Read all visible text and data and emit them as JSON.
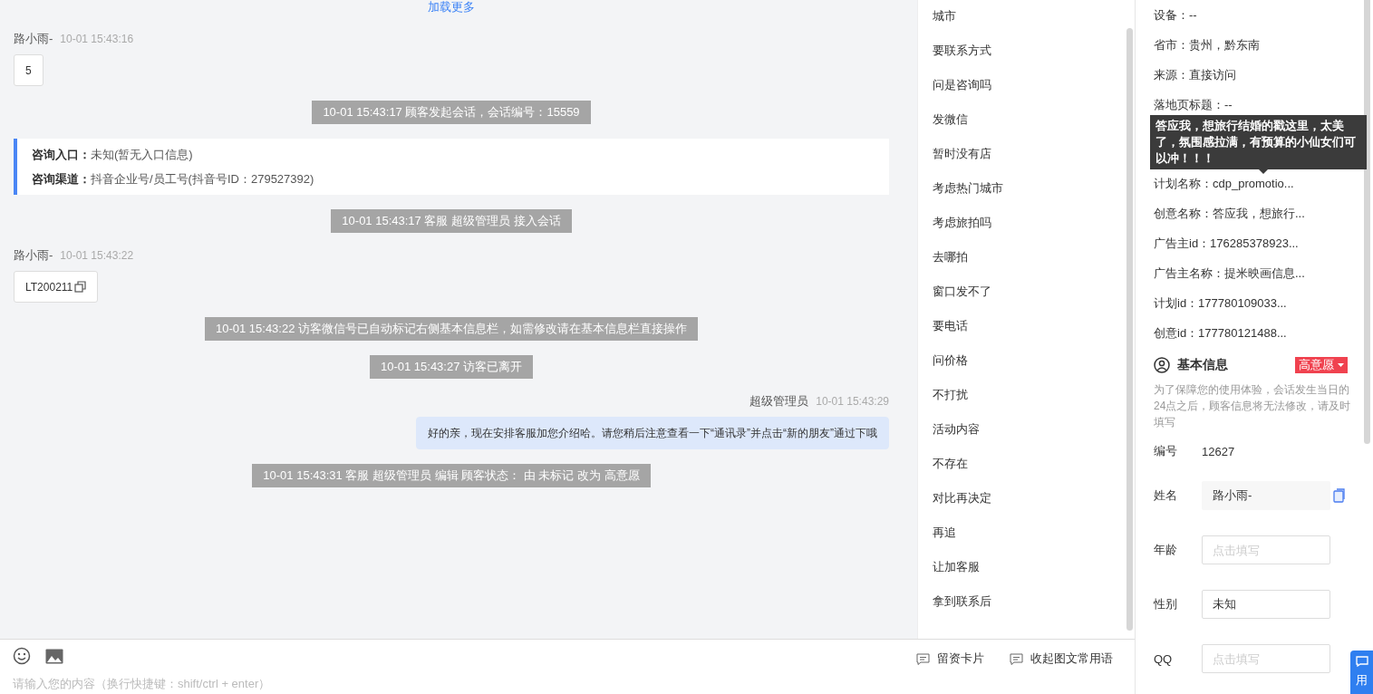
{
  "chat": {
    "load_more": "加载更多",
    "messages": [
      {
        "kind": "visitor",
        "sender": "路小雨-",
        "time": "10-01 15:43:16",
        "text": "5",
        "copyable": false
      },
      {
        "kind": "system",
        "text": "10-01 15:43:17 顾客发起会话，会话编号：15559"
      },
      {
        "kind": "source",
        "lines": [
          {
            "label": "咨询入口：",
            "value": "未知(暂无入口信息)"
          },
          {
            "label": "咨询渠道：",
            "value": "抖音企业号/员工号(抖音号ID：279527392)"
          }
        ]
      },
      {
        "kind": "system",
        "text": "10-01 15:43:17 客服 超级管理员 接入会话"
      },
      {
        "kind": "visitor",
        "sender": "路小雨-",
        "time": "10-01 15:43:22",
        "text": "LT200211",
        "copyable": true
      },
      {
        "kind": "system",
        "text": "10-01 15:43:22 访客微信号已自动标记右侧基本信息栏，如需修改请在基本信息栏直接操作"
      },
      {
        "kind": "system",
        "text": "10-01 15:43:27 访客已离开"
      },
      {
        "kind": "agent",
        "sender": "超级管理员",
        "time": "10-01 15:43:29",
        "text": "好的亲，现在安排客服加您介绍哈。请您稍后注意查看一下“通讯录”并点击“新的朋友”通过下哦"
      },
      {
        "kind": "system",
        "text": "10-01 15:43:31 客服 超级管理员 编辑 顾客状态： 由 未标记 改为 高意愿"
      }
    ]
  },
  "composer": {
    "placeholder": "请输入您的内容（换行快捷键：shift/ctrl + enter）",
    "actions": [
      "留资卡片",
      "收起图文常用语"
    ]
  },
  "phrases": [
    "城市",
    "要联系方式",
    "问是咨询吗",
    "发微信",
    "暂时没有店",
    "考虑热门城市",
    "考虑旅拍吗",
    "去哪拍",
    "窗口发不了",
    "要电话",
    "问价格",
    "不打扰",
    "活动内容",
    "不存在",
    "对比再决定",
    "再追",
    "让加客服",
    "拿到联系后"
  ],
  "visitor_info": {
    "rows": [
      "设备：--",
      "省市：贵州，黔东南",
      "来源：直接访问",
      "落地页标题：--",
      null,
      "计划名称：cdp_promotio...",
      "创意名称：答应我，想旅行...",
      "广告主id：176285378923...",
      "广告主名称：提米映画信息...",
      "计划id：177780109033...",
      "创意id：177780121488..."
    ],
    "tooltip": "答应我，想旅行结婚的戳这里，太美了，氛围感拉满，有预算的小仙女们可以冲！！！"
  },
  "basic_info": {
    "title": "基本信息",
    "intent_tag": "高意愿",
    "note": "为了保障您的使用体验，会话发生当日的24点之后，顾客信息将无法修改，请及时填写",
    "fields": [
      {
        "kind": "text",
        "label": "编号",
        "value": "12627"
      },
      {
        "kind": "input",
        "label": "姓名",
        "value": "路小雨-",
        "disabled": true,
        "copyable": true
      },
      {
        "kind": "input",
        "label": "年龄",
        "placeholder": "点击填写",
        "disabled": false,
        "copyable": false
      },
      {
        "kind": "input",
        "label": "性别",
        "value": "未知",
        "disabled": false,
        "copyable": false
      },
      {
        "kind": "input",
        "label": "QQ",
        "placeholder": "点击填写",
        "disabled": false,
        "copyable": false
      }
    ]
  },
  "float_button": "用"
}
